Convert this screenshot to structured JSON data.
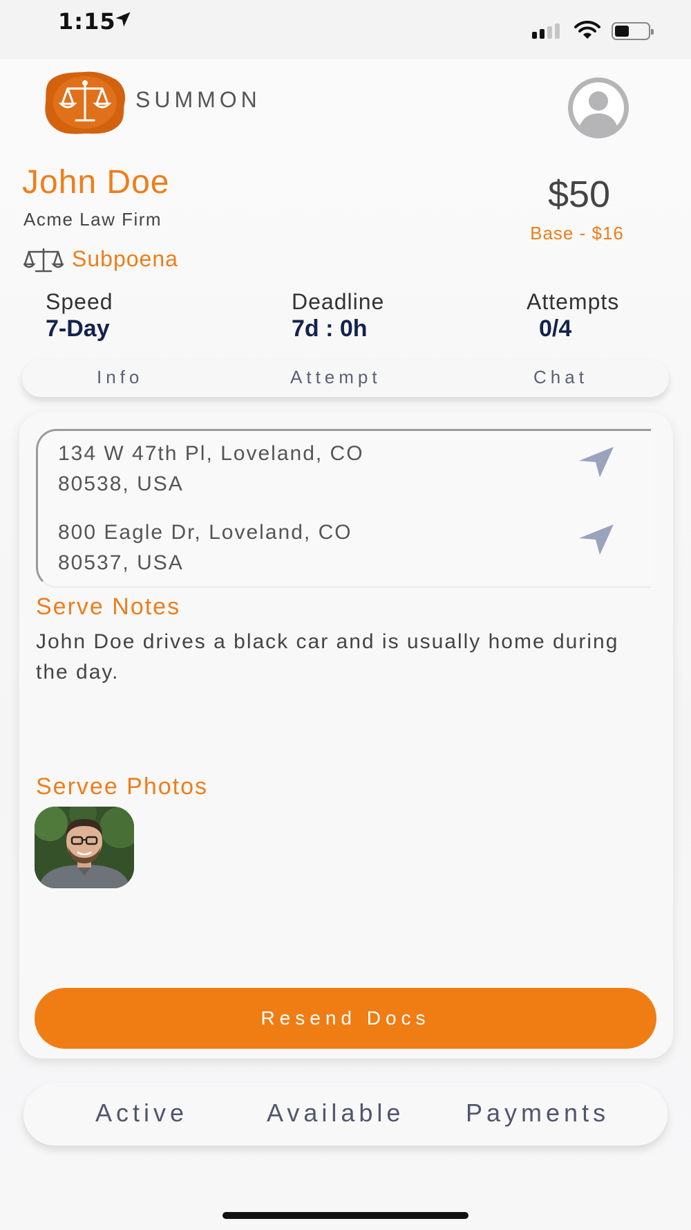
{
  "status_bar": {
    "time": "1:15"
  },
  "header": {
    "brand": "SUMMON",
    "logo_icon": "scales-seal-logo",
    "profile_icon": "user-icon"
  },
  "case": {
    "name": "John Doe",
    "firm": "Acme Law Firm",
    "document_type": "Subpoena",
    "price": "$50",
    "base": "Base - $16"
  },
  "stats": {
    "speed_label": "Speed",
    "speed_value": "7-Day",
    "deadline_label": "Deadline",
    "deadline_value": "7d : 0h",
    "attempts_label": "Attempts",
    "attempts_value": "0/4"
  },
  "tabs": {
    "info": "Info",
    "attempt": "Attempt",
    "chat": "Chat"
  },
  "addresses": [
    {
      "line1": "134 W 47th Pl, Loveland, CO",
      "line2": "80538, USA"
    },
    {
      "line1": "800 Eagle Dr, Loveland, CO",
      "line2": "80537, USA"
    }
  ],
  "notes": {
    "title": "Serve Notes",
    "text": "John Doe drives a black car and is usually home during the day."
  },
  "photos": {
    "title": "Servee Photos"
  },
  "actions": {
    "resend_label": "Resend Docs"
  },
  "bottom_nav": {
    "active": "Active",
    "available": "Available",
    "payments": "Payments"
  },
  "colors": {
    "accent": "#ef7d19",
    "navy": "#14224d",
    "tab_text": "#5a6075"
  }
}
